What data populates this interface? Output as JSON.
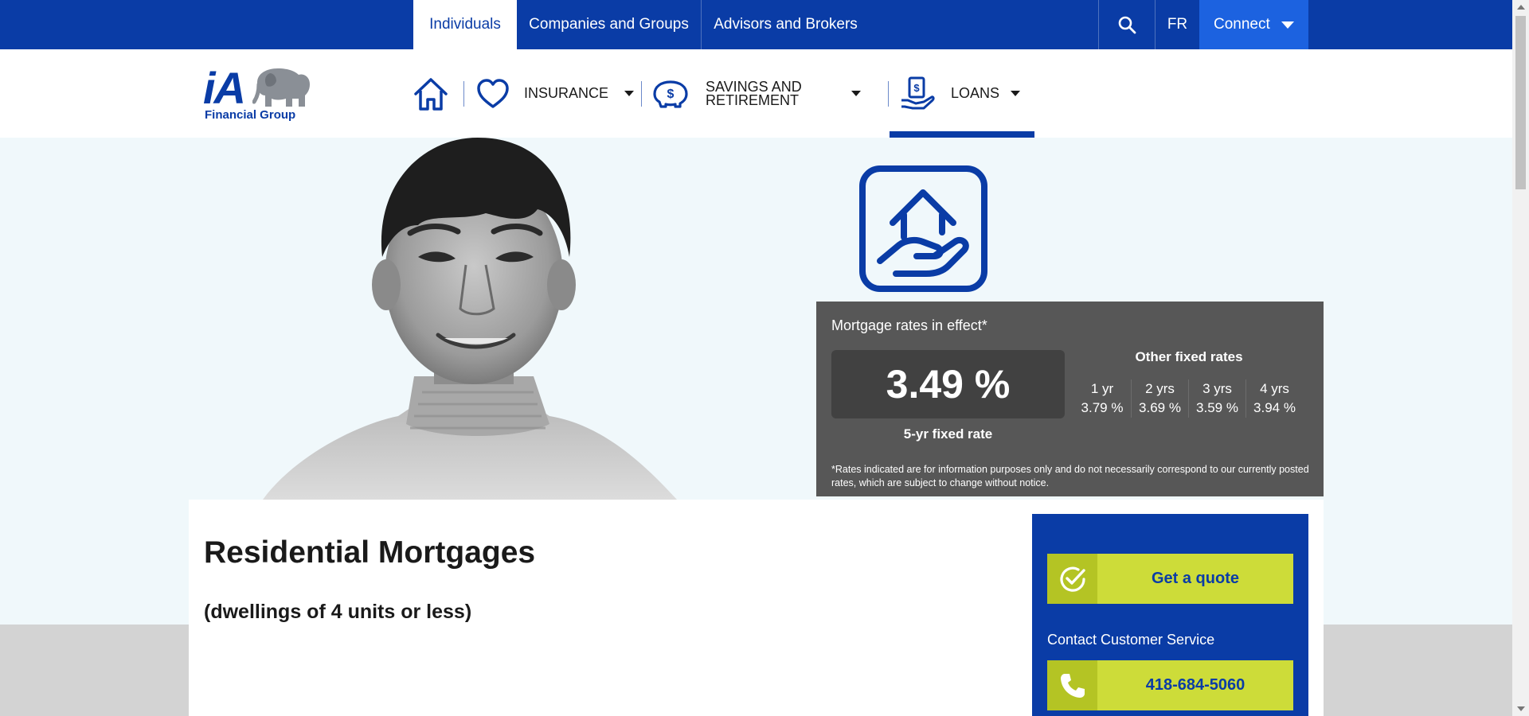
{
  "topbar": {
    "tabs": [
      {
        "label": "Individuals",
        "active": true
      },
      {
        "label": "Companies and Groups",
        "active": false
      },
      {
        "label": "Advisors and Brokers",
        "active": false
      }
    ],
    "lang": "FR",
    "connect": "Connect",
    "icons": {
      "search": "search-icon",
      "caret": "caret-down-icon"
    }
  },
  "brand": {
    "logo_text": "iA",
    "logo_subtitle": "Financial Group",
    "colors": {
      "primary": "#0a3ca6",
      "accent": "#cddc39",
      "connect": "#1c62e0"
    }
  },
  "mainnav": {
    "items": [
      {
        "label": "Insurance",
        "icon": "heart-icon"
      },
      {
        "label": "Savings and Retirement",
        "icon": "coin-piggy-icon"
      },
      {
        "label": "Loans",
        "icon": "hand-dollar-icon",
        "active": true
      }
    ],
    "home_icon": "home-icon"
  },
  "rates": {
    "title": "Mortgage rates in effect*",
    "main_rate": "3.49 %",
    "main_label": "5-yr fixed rate",
    "other_title": "Other fixed rates",
    "other": [
      {
        "term": "1 yr",
        "rate": "3.79 %"
      },
      {
        "term": "2 yrs",
        "rate": "3.69 %"
      },
      {
        "term": "3 yrs",
        "rate": "3.59 %"
      },
      {
        "term": "4 yrs",
        "rate": "3.94 %"
      }
    ],
    "note": "*Rates indicated are for information purposes only and do not necessarily correspond to our currently posted rates, which are subject to change without notice."
  },
  "page": {
    "title": "Residential Mortgages",
    "subtitle": "(dwellings of 4 units or less)"
  },
  "sidecard": {
    "quote_label": "Get a quote",
    "contact_label": "Contact Customer Service",
    "phone": "418-684-5060"
  }
}
